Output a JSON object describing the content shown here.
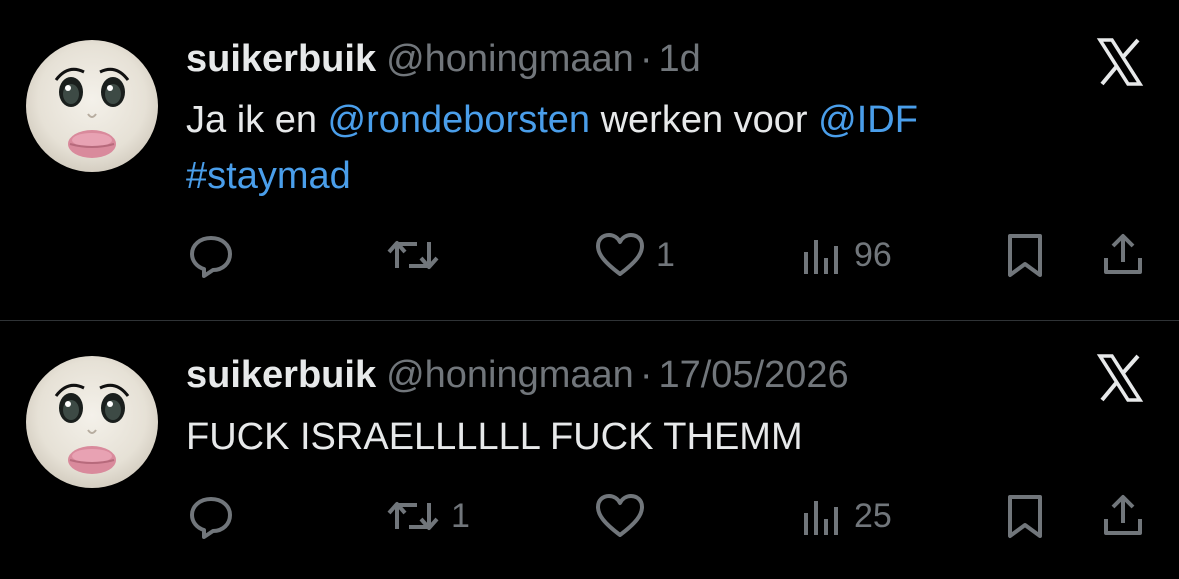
{
  "tweets": [
    {
      "display_name": "suikerbuik",
      "handle": "@honingmaan",
      "separator": "·",
      "time": "1d",
      "text_parts": {
        "p1": "Ja ik en ",
        "mention1": "@rondeborsten",
        "p2": " werken voor ",
        "mention2": "@IDF",
        "hashtag": "#staymad"
      },
      "actions": {
        "reply_count": "",
        "retweet_count": "",
        "like_count": "1",
        "views_count": "96"
      }
    },
    {
      "display_name": "suikerbuik",
      "handle": "@honingmaan",
      "separator": "·",
      "time": "17/05/2026",
      "text": "FUCK ISRAELLLLLL FUCK THEMM",
      "actions": {
        "reply_count": "",
        "retweet_count": "1",
        "like_count": "",
        "views_count": "25"
      }
    }
  ],
  "icons": {
    "reply": "reply-icon",
    "retweet": "retweet-icon",
    "like": "heart-icon",
    "views": "views-icon",
    "bookmark": "bookmark-icon",
    "share": "share-icon",
    "brand": "x-logo-icon"
  },
  "colors": {
    "background": "#000000",
    "primary_text": "#e7e9ea",
    "secondary_text": "#71767b",
    "link": "#4a9eea",
    "divider": "#2f3336"
  }
}
